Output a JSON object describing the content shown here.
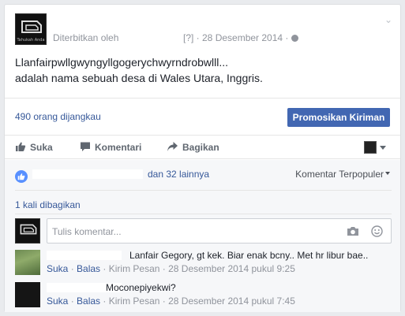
{
  "post": {
    "published_by": "Diterbitkan oleh",
    "meta": "[?] · 28 Desember 2014 ·",
    "page_avatar_caption": "Tahukah Anda",
    "text_line1": "Llanfairpwllgwyngyllgogerychwyrndrobwlll...",
    "text_line2": "adalah nama sebuah desa di Wales Utara, Inggris."
  },
  "insights": {
    "reach": "490 orang dijangkau",
    "promote_label": "Promosikan Kiriman"
  },
  "actions": {
    "like": "Suka",
    "comment": "Komentari",
    "share": "Bagikan"
  },
  "reactions": {
    "others": "dan 32 lainnya",
    "sort_label": "Komentar Terpopuler"
  },
  "shares": "1 kali dibagikan",
  "composer": {
    "placeholder": "Tulis komentar..."
  },
  "comments": [
    {
      "text": "Lanfair Gegory, gt kek. Biar enak bcny.. Met hr libur bae..",
      "like": "Suka",
      "reply": "Balas",
      "message": "Kirim Pesan",
      "time": "28 Desember 2014 pukul 9:25"
    },
    {
      "text": "Moconepiyekwi?",
      "like": "Suka",
      "reply": "Balas",
      "message": "Kirim Pesan",
      "time": "28 Desember 2014 pukul 7:45"
    }
  ],
  "colors": {
    "link": "#365899",
    "brand": "#4267b2",
    "muted": "#90949c",
    "like_bubble": "#5890ff"
  },
  "icons": [
    "chevron-down-icon",
    "globe-icon",
    "like-icon",
    "comment-icon",
    "share-icon",
    "camera-icon",
    "smiley-icon",
    "like-bubble-icon"
  ]
}
